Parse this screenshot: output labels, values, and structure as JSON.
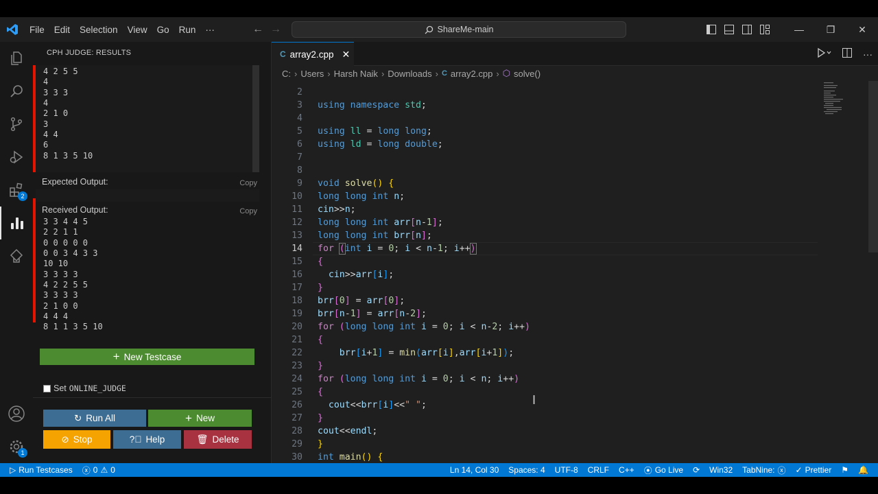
{
  "titlebar": {
    "menu": [
      "File",
      "Edit",
      "Selection",
      "View",
      "Go",
      "Run",
      "···"
    ],
    "search_text": "ShareMe-main"
  },
  "activity_bar": {
    "extensions_badge": "2",
    "settings_badge": "1"
  },
  "sidebar": {
    "header": "CPH JUDGE: RESULTS",
    "input_lines": [
      "4 2 5 5",
      "4",
      "3 3 3",
      "4",
      "2 1 0",
      "3",
      "4 4",
      "6",
      "8 1 3 5 10"
    ],
    "expected_label": "Expected Output:",
    "received_label": "Received Output:",
    "copy_label": "Copy",
    "received_lines": [
      "3 3 4 4 5",
      "2 2 1 1",
      "0 0 0 0 0",
      "0 0 3 4 3 3",
      "10 10",
      "3 3 3 3",
      "4 2 2 5 5",
      "3 3 3 3",
      "2 1 0 0",
      "4 4 4",
      "8 1 1 3 5 10"
    ],
    "new_testcase": "New Testcase",
    "set_label": "Set",
    "online_judge": "ONLINE_JUDGE",
    "run_all": "Run All",
    "new": "New",
    "stop": "Stop",
    "help": "Help",
    "delete": "Delete"
  },
  "editor": {
    "tab_name": "array2.cpp",
    "breadcrumb": [
      "C:",
      "Users",
      "Harsh Naik",
      "Downloads",
      "array2.cpp",
      "solve()"
    ],
    "current_line": "14",
    "lines": [
      {
        "n": "2",
        "html": ""
      },
      {
        "n": "3",
        "html": "<span class='k'>using</span> <span class='k'>namespace</span> <span class='t'>std</span><span class='p'>;</span>"
      },
      {
        "n": "4",
        "html": ""
      },
      {
        "n": "5",
        "html": "<span class='k'>using</span> <span class='t'>ll</span> <span class='p'>=</span> <span class='k'>long</span> <span class='k'>long</span><span class='p'>;</span>"
      },
      {
        "n": "6",
        "html": "<span class='k'>using</span> <span class='t'>ld</span> <span class='p'>=</span> <span class='k'>long</span> <span class='k'>double</span><span class='p'>;</span>"
      },
      {
        "n": "7",
        "html": ""
      },
      {
        "n": "8",
        "html": ""
      },
      {
        "n": "9",
        "html": "<span class='k'>void</span> <span class='f'>solve</span><span class='br1'>()</span> <span class='br1'>{</span>"
      },
      {
        "n": "10",
        "html": "<span class='k'>long</span> <span class='k'>long</span> <span class='k'>int</span> <span class='v'>n</span><span class='p'>;</span>"
      },
      {
        "n": "11",
        "html": "<span class='v'>cin</span><span class='p'>&gt;&gt;</span><span class='v'>n</span><span class='p'>;</span>"
      },
      {
        "n": "12",
        "html": "<span class='k'>long</span> <span class='k'>long</span> <span class='k'>int</span> <span class='v'>arr</span><span class='br2'>[</span><span class='v'>n</span><span class='p'>-</span><span class='n'>1</span><span class='br2'>]</span><span class='p'>;</span>"
      },
      {
        "n": "13",
        "html": "<span class='k'>long</span> <span class='k'>long</span> <span class='k'>int</span> <span class='v'>brr</span><span class='br2'>[</span><span class='v'>n</span><span class='br2'>]</span><span class='p'>;</span>"
      },
      {
        "n": "14",
        "html": "<span class='c'>for</span> <span class='br2' style='outline:1px solid #777;'>(</span><span class='k'>int</span> <span class='v'>i</span> <span class='p'>=</span> <span class='n'>0</span><span class='p'>;</span> <span class='v'>i</span> <span class='p'>&lt;</span> <span class='v'>n</span><span class='p'>-</span><span class='n'>1</span><span class='p'>;</span> <span class='v'>i</span><span class='p'>++</span><span class='br2' style='outline:1px solid #777;'>)</span>"
      },
      {
        "n": "15",
        "html": "<span class='br2'>{</span>"
      },
      {
        "n": "16",
        "html": "  <span class='v'>cin</span><span class='p'>&gt;&gt;</span><span class='v'>arr</span><span class='br3'>[</span><span class='v'>i</span><span class='br3'>]</span><span class='p'>;</span>"
      },
      {
        "n": "17",
        "html": "<span class='br2'>}</span>"
      },
      {
        "n": "18",
        "html": "<span class='v'>brr</span><span class='br2'>[</span><span class='n'>0</span><span class='br2'>]</span> <span class='p'>=</span> <span class='v'>arr</span><span class='br2'>[</span><span class='n'>0</span><span class='br2'>]</span><span class='p'>;</span>"
      },
      {
        "n": "19",
        "html": "<span class='v'>brr</span><span class='br2'>[</span><span class='v'>n</span><span class='p'>-</span><span class='n'>1</span><span class='br2'>]</span> <span class='p'>=</span> <span class='v'>arr</span><span class='br2'>[</span><span class='v'>n</span><span class='p'>-</span><span class='n'>2</span><span class='br2'>]</span><span class='p'>;</span>"
      },
      {
        "n": "20",
        "html": "<span class='c'>for</span> <span class='br2'>(</span><span class='k'>long</span> <span class='k'>long</span> <span class='k'>int</span> <span class='v'>i</span> <span class='p'>=</span> <span class='n'>0</span><span class='p'>;</span> <span class='v'>i</span> <span class='p'>&lt;</span> <span class='v'>n</span><span class='p'>-</span><span class='n'>2</span><span class='p'>;</span> <span class='v'>i</span><span class='p'>++</span><span class='br2'>)</span>"
      },
      {
        "n": "21",
        "html": "<span class='br2'>{</span>"
      },
      {
        "n": "22",
        "html": "    <span class='v'>brr</span><span class='br3'>[</span><span class='v'>i</span><span class='p'>+</span><span class='n'>1</span><span class='br3'>]</span> <span class='p'>=</span> <span class='f'>min</span><span class='br3'>(</span><span class='v'>arr</span><span class='br1'>[</span><span class='v'>i</span><span class='br1'>]</span><span class='p'>,</span><span class='v'>arr</span><span class='br1'>[</span><span class='v'>i</span><span class='p'>+</span><span class='n'>1</span><span class='br1'>]</span><span class='br3'>)</span><span class='p'>;</span>"
      },
      {
        "n": "23",
        "html": "<span class='br2'>}</span>"
      },
      {
        "n": "24",
        "html": "<span class='c'>for</span> <span class='br2'>(</span><span class='k'>long</span> <span class='k'>long</span> <span class='k'>int</span> <span class='v'>i</span> <span class='p'>=</span> <span class='n'>0</span><span class='p'>;</span> <span class='v'>i</span> <span class='p'>&lt;</span> <span class='v'>n</span><span class='p'>;</span> <span class='v'>i</span><span class='p'>++</span><span class='br2'>)</span>"
      },
      {
        "n": "25",
        "html": "<span class='br2'>{</span>"
      },
      {
        "n": "26",
        "html": "  <span class='v'>cout</span><span class='p'>&lt;&lt;</span><span class='v'>brr</span><span class='br3'>[</span><span class='v'>i</span><span class='br3'>]</span><span class='p'>&lt;&lt;</span><span class='s'>\" \"</span><span class='p'>;</span>"
      },
      {
        "n": "27",
        "html": "<span class='br2'>}</span>"
      },
      {
        "n": "28",
        "html": "<span class='v'>cout</span><span class='p'>&lt;&lt;</span><span class='v'>endl</span><span class='p'>;</span>"
      },
      {
        "n": "29",
        "html": "<span class='br1'>}</span>"
      },
      {
        "n": "30",
        "html": "<span class='k'>int</span> <span class='f'>main</span><span class='br1'>()</span> <span class='br1'>{</span>"
      }
    ]
  },
  "statusbar": {
    "run_testcases": "Run Testcases",
    "errors": "0",
    "warnings": "0",
    "position": "Ln 14, Col 30",
    "spaces": "Spaces: 4",
    "encoding": "UTF-8",
    "eol": "CRLF",
    "language": "C++",
    "go_live": "Go Live",
    "platform": "Win32",
    "tabnine": "TabNine:",
    "prettier": "Prettier"
  },
  "colors": {
    "accent": "#0078d4",
    "error_bar": "#e51400",
    "new_testcase_bg": "#4d8b31",
    "stop_bg": "#f5a300",
    "help_bg": "#3e6d93",
    "delete_bg": "#a83240",
    "run_all_bg": "#3e6d93"
  },
  "icons": [
    "vscode-logo-icon",
    "search-icon",
    "explorer-icon",
    "source-control-icon",
    "run-debug-icon",
    "extensions-icon",
    "cph-judge-icon",
    "remote-icon",
    "account-icon",
    "settings-gear-icon",
    "close-icon",
    "run-icon",
    "split-editor-icon",
    "more-icon"
  ]
}
